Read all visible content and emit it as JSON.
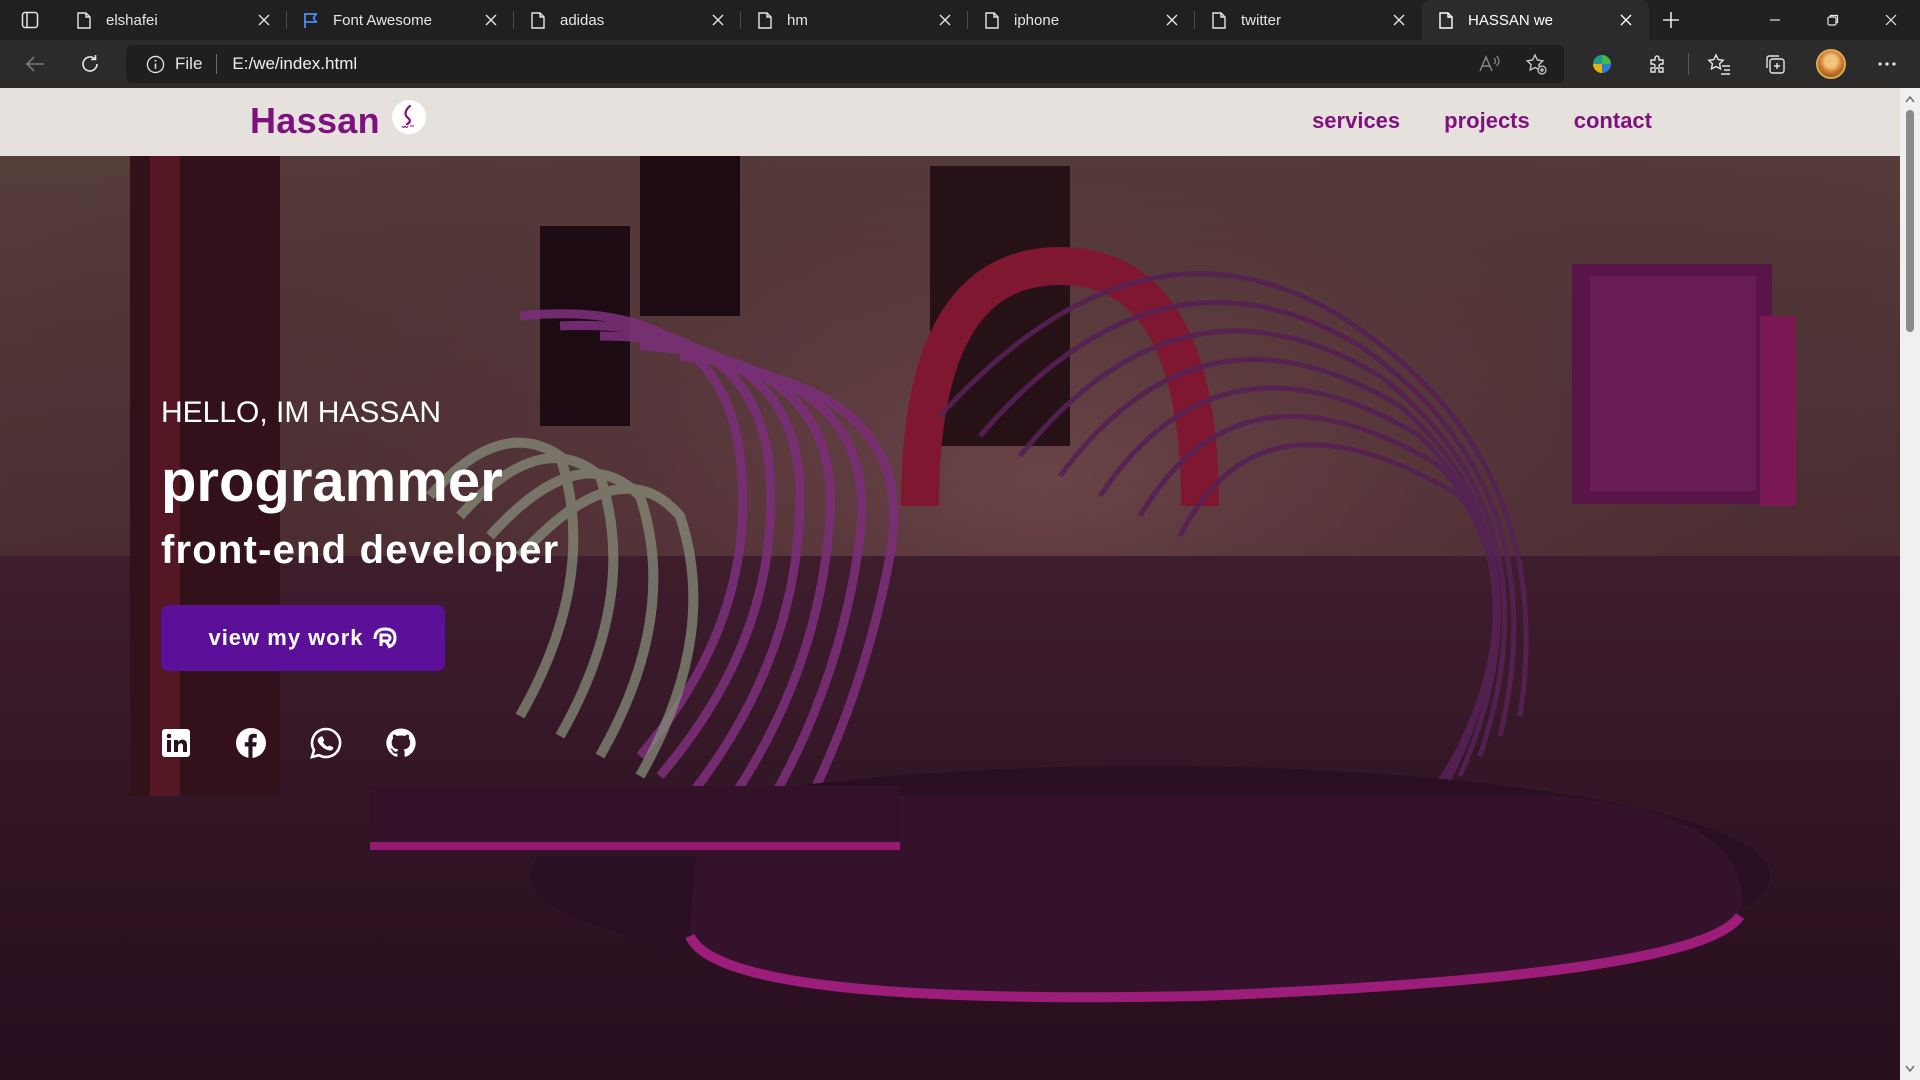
{
  "browser": {
    "tabs": [
      {
        "title": "elshafei",
        "icon": "page-icon"
      },
      {
        "title": "Font Awesome",
        "icon": "flag-icon"
      },
      {
        "title": "adidas",
        "icon": "page-icon"
      },
      {
        "title": "hm",
        "icon": "page-icon"
      },
      {
        "title": "iphone",
        "icon": "page-icon"
      },
      {
        "title": "twitter",
        "icon": "page-icon"
      },
      {
        "title": "HASSAN we",
        "icon": "page-icon",
        "active": true
      }
    ],
    "address": {
      "scheme_label": "File",
      "url": "E:/we/index.html"
    }
  },
  "site": {
    "brand": "Hassan",
    "brand_logo": "we-logo-icon",
    "nav": [
      "services",
      "projects",
      "contact"
    ],
    "hero": {
      "greeting": "HELLO, IM HASSAN",
      "title": "programmer",
      "subtitle": "front-end developer",
      "cta_label": "view my work",
      "cta_icon": "registered-icon"
    },
    "socials": [
      "linkedin-icon",
      "facebook-icon",
      "whatsapp-icon",
      "github-icon"
    ]
  },
  "colors": {
    "brand_purple": "#7d127f",
    "cta_purple": "#5c0f99",
    "navbar_bg": "#e6e1dc",
    "browser_dark": "#202020"
  }
}
